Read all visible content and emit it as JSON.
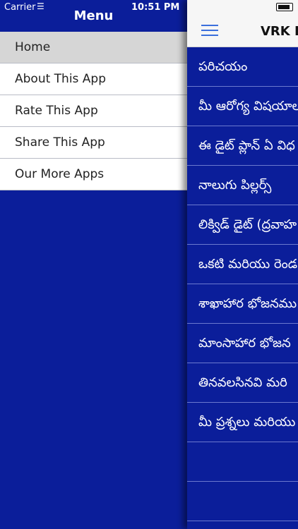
{
  "status_bar": {
    "carrier": "Carrier",
    "time": "10:51 PM"
  },
  "menu": {
    "title": "Menu",
    "items": [
      {
        "label": "Home"
      },
      {
        "label": "About This App"
      },
      {
        "label": "Rate This App"
      },
      {
        "label": "Share This App"
      },
      {
        "label": "Our More Apps"
      }
    ]
  },
  "nav": {
    "title": "VRK D"
  },
  "list": [
    {
      "label": "పరిచయం"
    },
    {
      "label": "మీ ఆరోగ్య విషయాల"
    },
    {
      "label": "ఈ డైట్ ప్లాన్ ఏ విధ"
    },
    {
      "label": "నాలుగు పిల్లర్స్"
    },
    {
      "label": "లిక్విడ్ డైట్ (ద్రవాహ"
    },
    {
      "label": "ఒకటి మరియు రెండ"
    },
    {
      "label": "శాఖాహార భోజనము"
    },
    {
      "label": "మాంసాహార భోజన"
    },
    {
      "label": "తినవలసినవి మరి"
    },
    {
      "label": "మీ ప్రశ్నలు మరియు"
    },
    {
      "label": ""
    },
    {
      "label": ""
    }
  ],
  "colors": {
    "primary": "#0b1e9a",
    "menu_active": "#d6d6d6",
    "hamburger": "#3b6fdc"
  }
}
